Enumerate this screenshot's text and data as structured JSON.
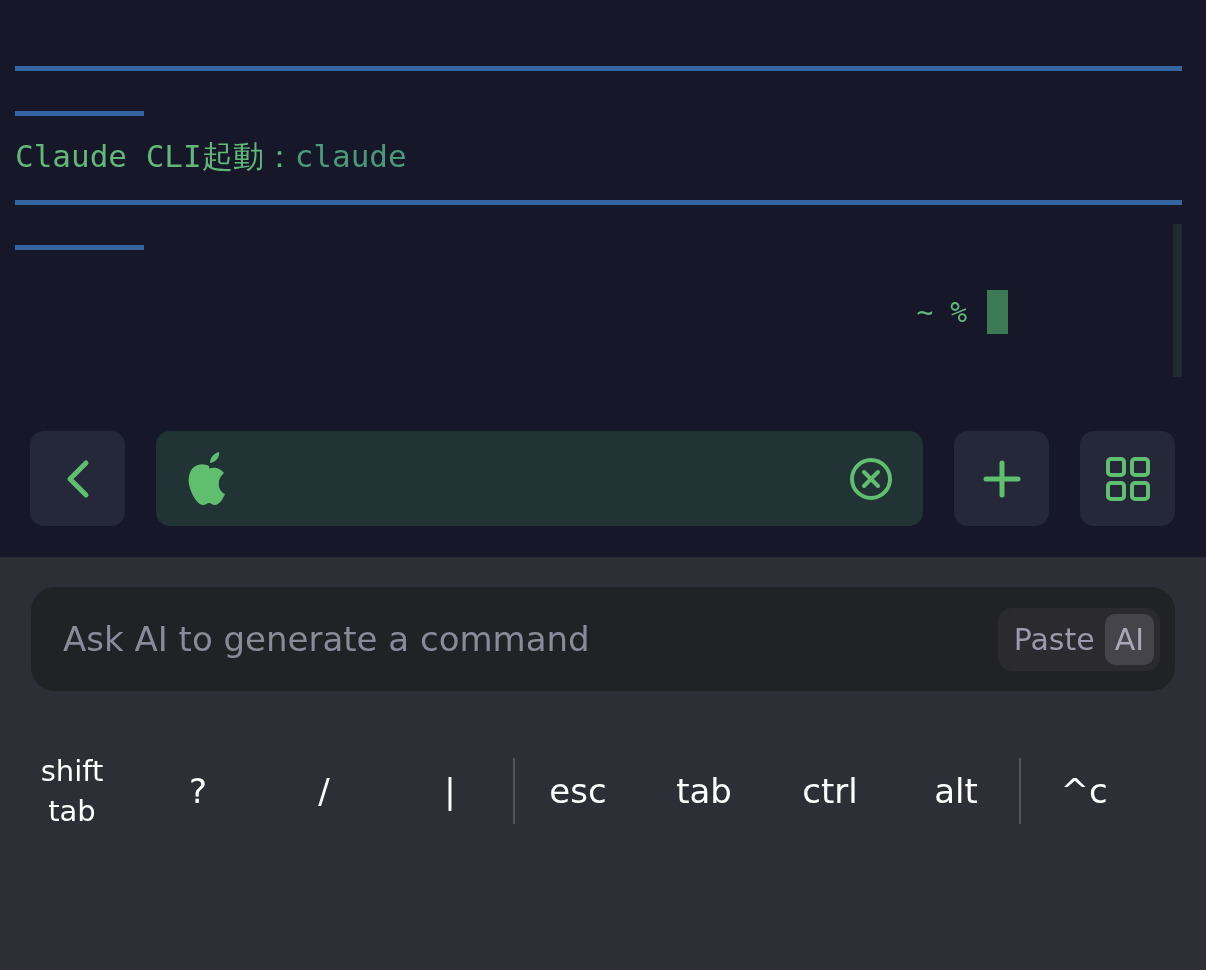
{
  "terminal": {
    "lines": [
      {
        "kind": "long_rule"
      },
      {
        "kind": "short_rule"
      },
      {
        "kind": "text",
        "label": "Claude CLI起動：",
        "command": "claude"
      },
      {
        "kind": "long_rule"
      },
      {
        "kind": "short_rule"
      }
    ],
    "prompt": "~ %"
  },
  "ai_field": {
    "placeholder": "Ask AI to generate a command",
    "segments": [
      {
        "label": "Paste",
        "selected": false
      },
      {
        "label": "AI",
        "selected": true
      }
    ]
  },
  "keys": [
    {
      "kind": "key",
      "label": "shift\ntab"
    },
    {
      "kind": "key",
      "label": "?"
    },
    {
      "kind": "key",
      "label": "/"
    },
    {
      "kind": "key",
      "label": "|"
    },
    {
      "kind": "separator"
    },
    {
      "kind": "key",
      "label": "esc"
    },
    {
      "kind": "key",
      "label": "tab"
    },
    {
      "kind": "key",
      "label": "ctrl"
    },
    {
      "kind": "key",
      "label": "alt"
    },
    {
      "kind": "separator"
    },
    {
      "kind": "key",
      "label": "^c"
    }
  ]
}
